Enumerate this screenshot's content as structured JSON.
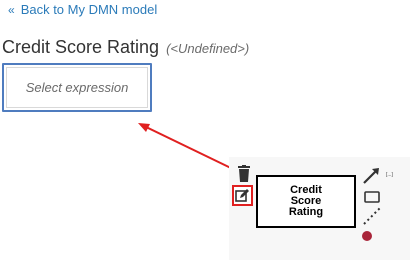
{
  "nav": {
    "back_chevron": "«",
    "back_label": "Back to My DMN model"
  },
  "header": {
    "title": "Credit Score Rating",
    "type_label": "(<Undefined>)"
  },
  "expression": {
    "placeholder": "Select expression"
  },
  "diagram": {
    "node_label": "Credit Score Rating",
    "connector_tag": "[...]",
    "accent_color": "#e02020",
    "marker_color": "#a9253a",
    "icons": [
      "trash-icon",
      "edit-icon",
      "connect-arrow-icon",
      "rectangle-icon",
      "dotted-line-icon",
      "circle-marker-icon"
    ]
  }
}
